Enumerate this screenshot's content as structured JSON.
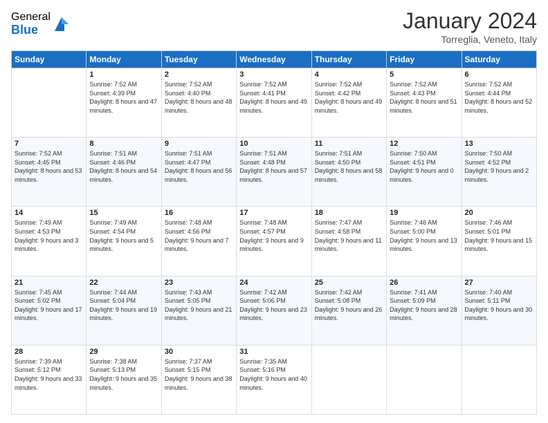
{
  "logo": {
    "general": "General",
    "blue": "Blue"
  },
  "header": {
    "title": "January 2024",
    "subtitle": "Torreglia, Veneto, Italy"
  },
  "columns": [
    "Sunday",
    "Monday",
    "Tuesday",
    "Wednesday",
    "Thursday",
    "Friday",
    "Saturday"
  ],
  "weeks": [
    [
      {
        "day": "",
        "sunrise": "",
        "sunset": "",
        "daylight": ""
      },
      {
        "day": "1",
        "sunrise": "Sunrise: 7:52 AM",
        "sunset": "Sunset: 4:39 PM",
        "daylight": "Daylight: 8 hours and 47 minutes."
      },
      {
        "day": "2",
        "sunrise": "Sunrise: 7:52 AM",
        "sunset": "Sunset: 4:40 PM",
        "daylight": "Daylight: 8 hours and 48 minutes."
      },
      {
        "day": "3",
        "sunrise": "Sunrise: 7:52 AM",
        "sunset": "Sunset: 4:41 PM",
        "daylight": "Daylight: 8 hours and 49 minutes."
      },
      {
        "day": "4",
        "sunrise": "Sunrise: 7:52 AM",
        "sunset": "Sunset: 4:42 PM",
        "daylight": "Daylight: 8 hours and 49 minutes."
      },
      {
        "day": "5",
        "sunrise": "Sunrise: 7:52 AM",
        "sunset": "Sunset: 4:43 PM",
        "daylight": "Daylight: 8 hours and 51 minutes."
      },
      {
        "day": "6",
        "sunrise": "Sunrise: 7:52 AM",
        "sunset": "Sunset: 4:44 PM",
        "daylight": "Daylight: 8 hours and 52 minutes."
      }
    ],
    [
      {
        "day": "7",
        "sunrise": "Sunrise: 7:52 AM",
        "sunset": "Sunset: 4:45 PM",
        "daylight": "Daylight: 8 hours and 53 minutes."
      },
      {
        "day": "8",
        "sunrise": "Sunrise: 7:51 AM",
        "sunset": "Sunset: 4:46 PM",
        "daylight": "Daylight: 8 hours and 54 minutes."
      },
      {
        "day": "9",
        "sunrise": "Sunrise: 7:51 AM",
        "sunset": "Sunset: 4:47 PM",
        "daylight": "Daylight: 8 hours and 56 minutes."
      },
      {
        "day": "10",
        "sunrise": "Sunrise: 7:51 AM",
        "sunset": "Sunset: 4:48 PM",
        "daylight": "Daylight: 8 hours and 57 minutes."
      },
      {
        "day": "11",
        "sunrise": "Sunrise: 7:51 AM",
        "sunset": "Sunset: 4:50 PM",
        "daylight": "Daylight: 8 hours and 58 minutes."
      },
      {
        "day": "12",
        "sunrise": "Sunrise: 7:50 AM",
        "sunset": "Sunset: 4:51 PM",
        "daylight": "Daylight: 9 hours and 0 minutes."
      },
      {
        "day": "13",
        "sunrise": "Sunrise: 7:50 AM",
        "sunset": "Sunset: 4:52 PM",
        "daylight": "Daylight: 9 hours and 2 minutes."
      }
    ],
    [
      {
        "day": "14",
        "sunrise": "Sunrise: 7:49 AM",
        "sunset": "Sunset: 4:53 PM",
        "daylight": "Daylight: 9 hours and 3 minutes."
      },
      {
        "day": "15",
        "sunrise": "Sunrise: 7:49 AM",
        "sunset": "Sunset: 4:54 PM",
        "daylight": "Daylight: 9 hours and 5 minutes."
      },
      {
        "day": "16",
        "sunrise": "Sunrise: 7:48 AM",
        "sunset": "Sunset: 4:56 PM",
        "daylight": "Daylight: 9 hours and 7 minutes."
      },
      {
        "day": "17",
        "sunrise": "Sunrise: 7:48 AM",
        "sunset": "Sunset: 4:57 PM",
        "daylight": "Daylight: 9 hours and 9 minutes."
      },
      {
        "day": "18",
        "sunrise": "Sunrise: 7:47 AM",
        "sunset": "Sunset: 4:58 PM",
        "daylight": "Daylight: 9 hours and 11 minutes."
      },
      {
        "day": "19",
        "sunrise": "Sunrise: 7:46 AM",
        "sunset": "Sunset: 5:00 PM",
        "daylight": "Daylight: 9 hours and 13 minutes."
      },
      {
        "day": "20",
        "sunrise": "Sunrise: 7:46 AM",
        "sunset": "Sunset: 5:01 PM",
        "daylight": "Daylight: 9 hours and 15 minutes."
      }
    ],
    [
      {
        "day": "21",
        "sunrise": "Sunrise: 7:45 AM",
        "sunset": "Sunset: 5:02 PM",
        "daylight": "Daylight: 9 hours and 17 minutes."
      },
      {
        "day": "22",
        "sunrise": "Sunrise: 7:44 AM",
        "sunset": "Sunset: 5:04 PM",
        "daylight": "Daylight: 9 hours and 19 minutes."
      },
      {
        "day": "23",
        "sunrise": "Sunrise: 7:43 AM",
        "sunset": "Sunset: 5:05 PM",
        "daylight": "Daylight: 9 hours and 21 minutes."
      },
      {
        "day": "24",
        "sunrise": "Sunrise: 7:42 AM",
        "sunset": "Sunset: 5:06 PM",
        "daylight": "Daylight: 9 hours and 23 minutes."
      },
      {
        "day": "25",
        "sunrise": "Sunrise: 7:42 AM",
        "sunset": "Sunset: 5:08 PM",
        "daylight": "Daylight: 9 hours and 26 minutes."
      },
      {
        "day": "26",
        "sunrise": "Sunrise: 7:41 AM",
        "sunset": "Sunset: 5:09 PM",
        "daylight": "Daylight: 9 hours and 28 minutes."
      },
      {
        "day": "27",
        "sunrise": "Sunrise: 7:40 AM",
        "sunset": "Sunset: 5:11 PM",
        "daylight": "Daylight: 9 hours and 30 minutes."
      }
    ],
    [
      {
        "day": "28",
        "sunrise": "Sunrise: 7:39 AM",
        "sunset": "Sunset: 5:12 PM",
        "daylight": "Daylight: 9 hours and 33 minutes."
      },
      {
        "day": "29",
        "sunrise": "Sunrise: 7:38 AM",
        "sunset": "Sunset: 5:13 PM",
        "daylight": "Daylight: 9 hours and 35 minutes."
      },
      {
        "day": "30",
        "sunrise": "Sunrise: 7:37 AM",
        "sunset": "Sunset: 5:15 PM",
        "daylight": "Daylight: 9 hours and 38 minutes."
      },
      {
        "day": "31",
        "sunrise": "Sunrise: 7:35 AM",
        "sunset": "Sunset: 5:16 PM",
        "daylight": "Daylight: 9 hours and 40 minutes."
      },
      {
        "day": "",
        "sunrise": "",
        "sunset": "",
        "daylight": ""
      },
      {
        "day": "",
        "sunrise": "",
        "sunset": "",
        "daylight": ""
      },
      {
        "day": "",
        "sunrise": "",
        "sunset": "",
        "daylight": ""
      }
    ]
  ]
}
